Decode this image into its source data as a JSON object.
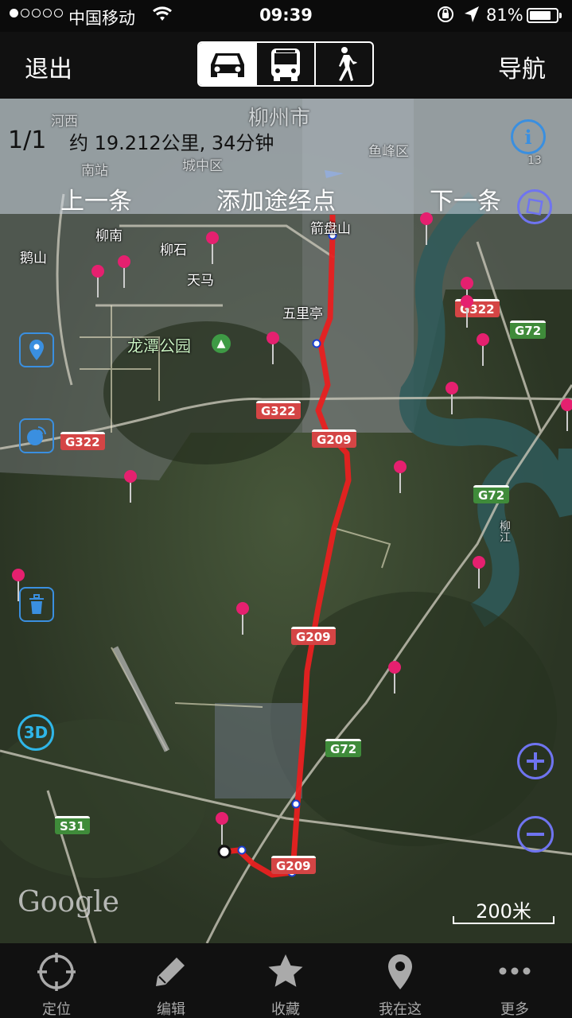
{
  "status_bar": {
    "signal_dots_filled": 1,
    "signal_dots_total": 5,
    "carrier": "中国移动",
    "time": "09:39",
    "battery_percent": "81%",
    "battery_level": 0.81
  },
  "nav": {
    "exit_label": "退出",
    "navigate_label": "导航",
    "modes": [
      {
        "name": "car-icon",
        "active": true
      },
      {
        "name": "bus-icon",
        "active": false
      },
      {
        "name": "walk-icon",
        "active": false
      }
    ]
  },
  "route_info": {
    "count": "1/1",
    "summary": "约 19.212公里, 34分钟",
    "prev_label": "上一条",
    "add_waypoint_label": "添加途经点",
    "next_label": "下一条"
  },
  "map_labels": {
    "liuzhou": "柳州市",
    "hexi": "河西",
    "yufengqu": "鱼峰区",
    "nanzhan": "南站",
    "chengzhongqu": "城中区",
    "jianpanshan": "箭盘山",
    "liunan": "柳南",
    "liushi": "柳石",
    "eshan": "鹅山",
    "tianma": "天马",
    "wulit": "五里亭",
    "longtan": "龙潭公园",
    "liujiang": "柳江",
    "shield_13": "13"
  },
  "road_shields": {
    "g322": "G322",
    "g209": "G209",
    "g72": "G72",
    "s31": "S31"
  },
  "map_attribution": "Google",
  "scale_label": "200米",
  "colors": {
    "route": "#e82020",
    "accent": "#6f74f0",
    "sidebar_icon": "#3a8fe0"
  },
  "tabs": [
    {
      "name": "locate",
      "label": "定位",
      "icon": "crosshair-icon"
    },
    {
      "name": "edit",
      "label": "编辑",
      "icon": "pencil-icon"
    },
    {
      "name": "favorite",
      "label": "收藏",
      "icon": "star-icon"
    },
    {
      "name": "here",
      "label": "我在这",
      "icon": "pin-icon"
    },
    {
      "name": "more",
      "label": "更多",
      "icon": "more-dots-icon"
    }
  ]
}
